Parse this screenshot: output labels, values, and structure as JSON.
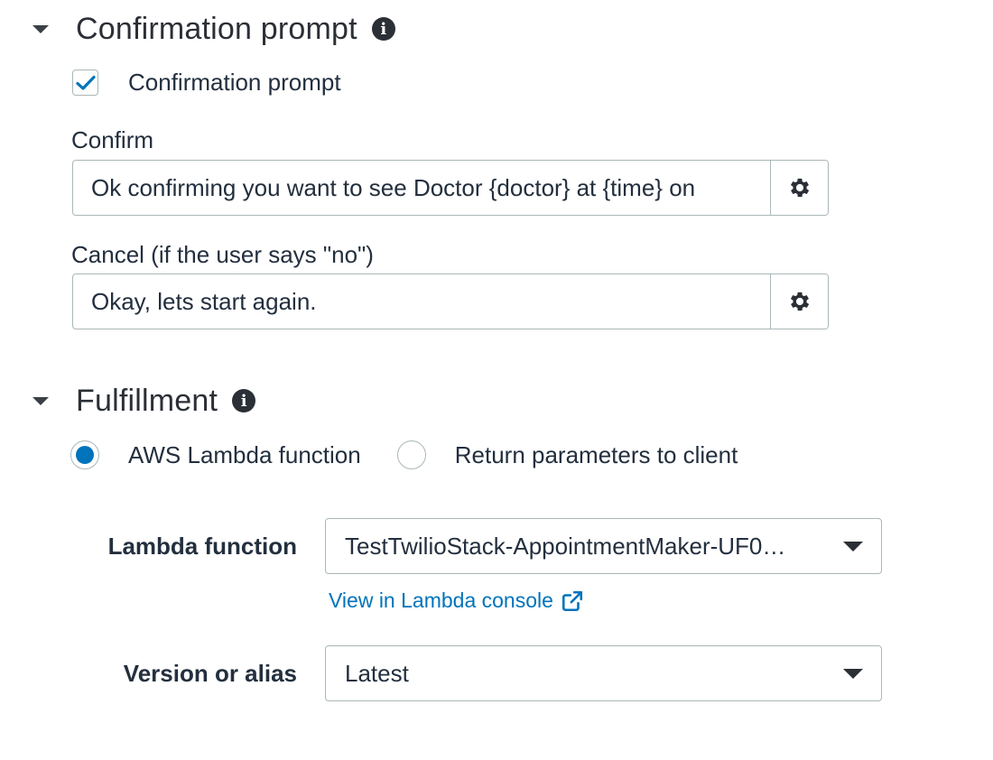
{
  "confirmation_section": {
    "title": "Confirmation prompt",
    "checkbox_label": "Confirmation prompt",
    "checkbox_checked": true,
    "confirm_label": "Confirm",
    "confirm_value": "Ok confirming you want to see Doctor {doctor} at {time} on",
    "cancel_label": "Cancel (if the user says \"no\")",
    "cancel_value": "Okay, lets start again."
  },
  "fulfillment_section": {
    "title": "Fulfillment",
    "options": [
      {
        "label": "AWS Lambda function",
        "selected": true
      },
      {
        "label": "Return parameters to client",
        "selected": false
      }
    ],
    "lambda_label": "Lambda function",
    "lambda_value": "TestTwilioStack-AppointmentMaker-UF0…",
    "console_link": "View in Lambda console",
    "version_label": "Version or alias",
    "version_value": "Latest"
  },
  "icons": {
    "collapse": "caret-down-icon",
    "info": "info-icon",
    "settings": "gear-icon",
    "external": "external-link-icon"
  },
  "colors": {
    "accent": "#0073bb",
    "text": "#232f3e",
    "border": "#aab7b8"
  }
}
